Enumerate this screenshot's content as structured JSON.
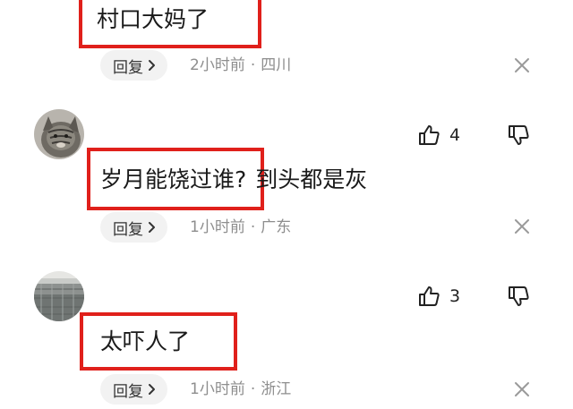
{
  "comments": [
    {
      "text_highlighted": "村口大妈了",
      "text_rest": "",
      "reply_label": "回复",
      "time": "2小时前",
      "location": "四川",
      "separator": "·"
    },
    {
      "text_highlighted": "岁月能饶过谁?",
      "text_rest": "到头都是灰",
      "reply_label": "回复",
      "time": "1小时前",
      "location": "广东",
      "separator": "·",
      "likes": "4"
    },
    {
      "text_highlighted": "太吓人了",
      "text_rest": "",
      "reply_label": "回复",
      "time": "1小时前",
      "location": "浙江",
      "separator": "·",
      "likes": "3"
    }
  ],
  "colors": {
    "highlight_border": "#e0201b",
    "meta_text": "#8e8e8e",
    "reply_bg": "#f2f2f2"
  },
  "icons": [
    "thumbs-up-icon",
    "thumbs-down-icon",
    "close-icon",
    "chevron-right-icon"
  ]
}
